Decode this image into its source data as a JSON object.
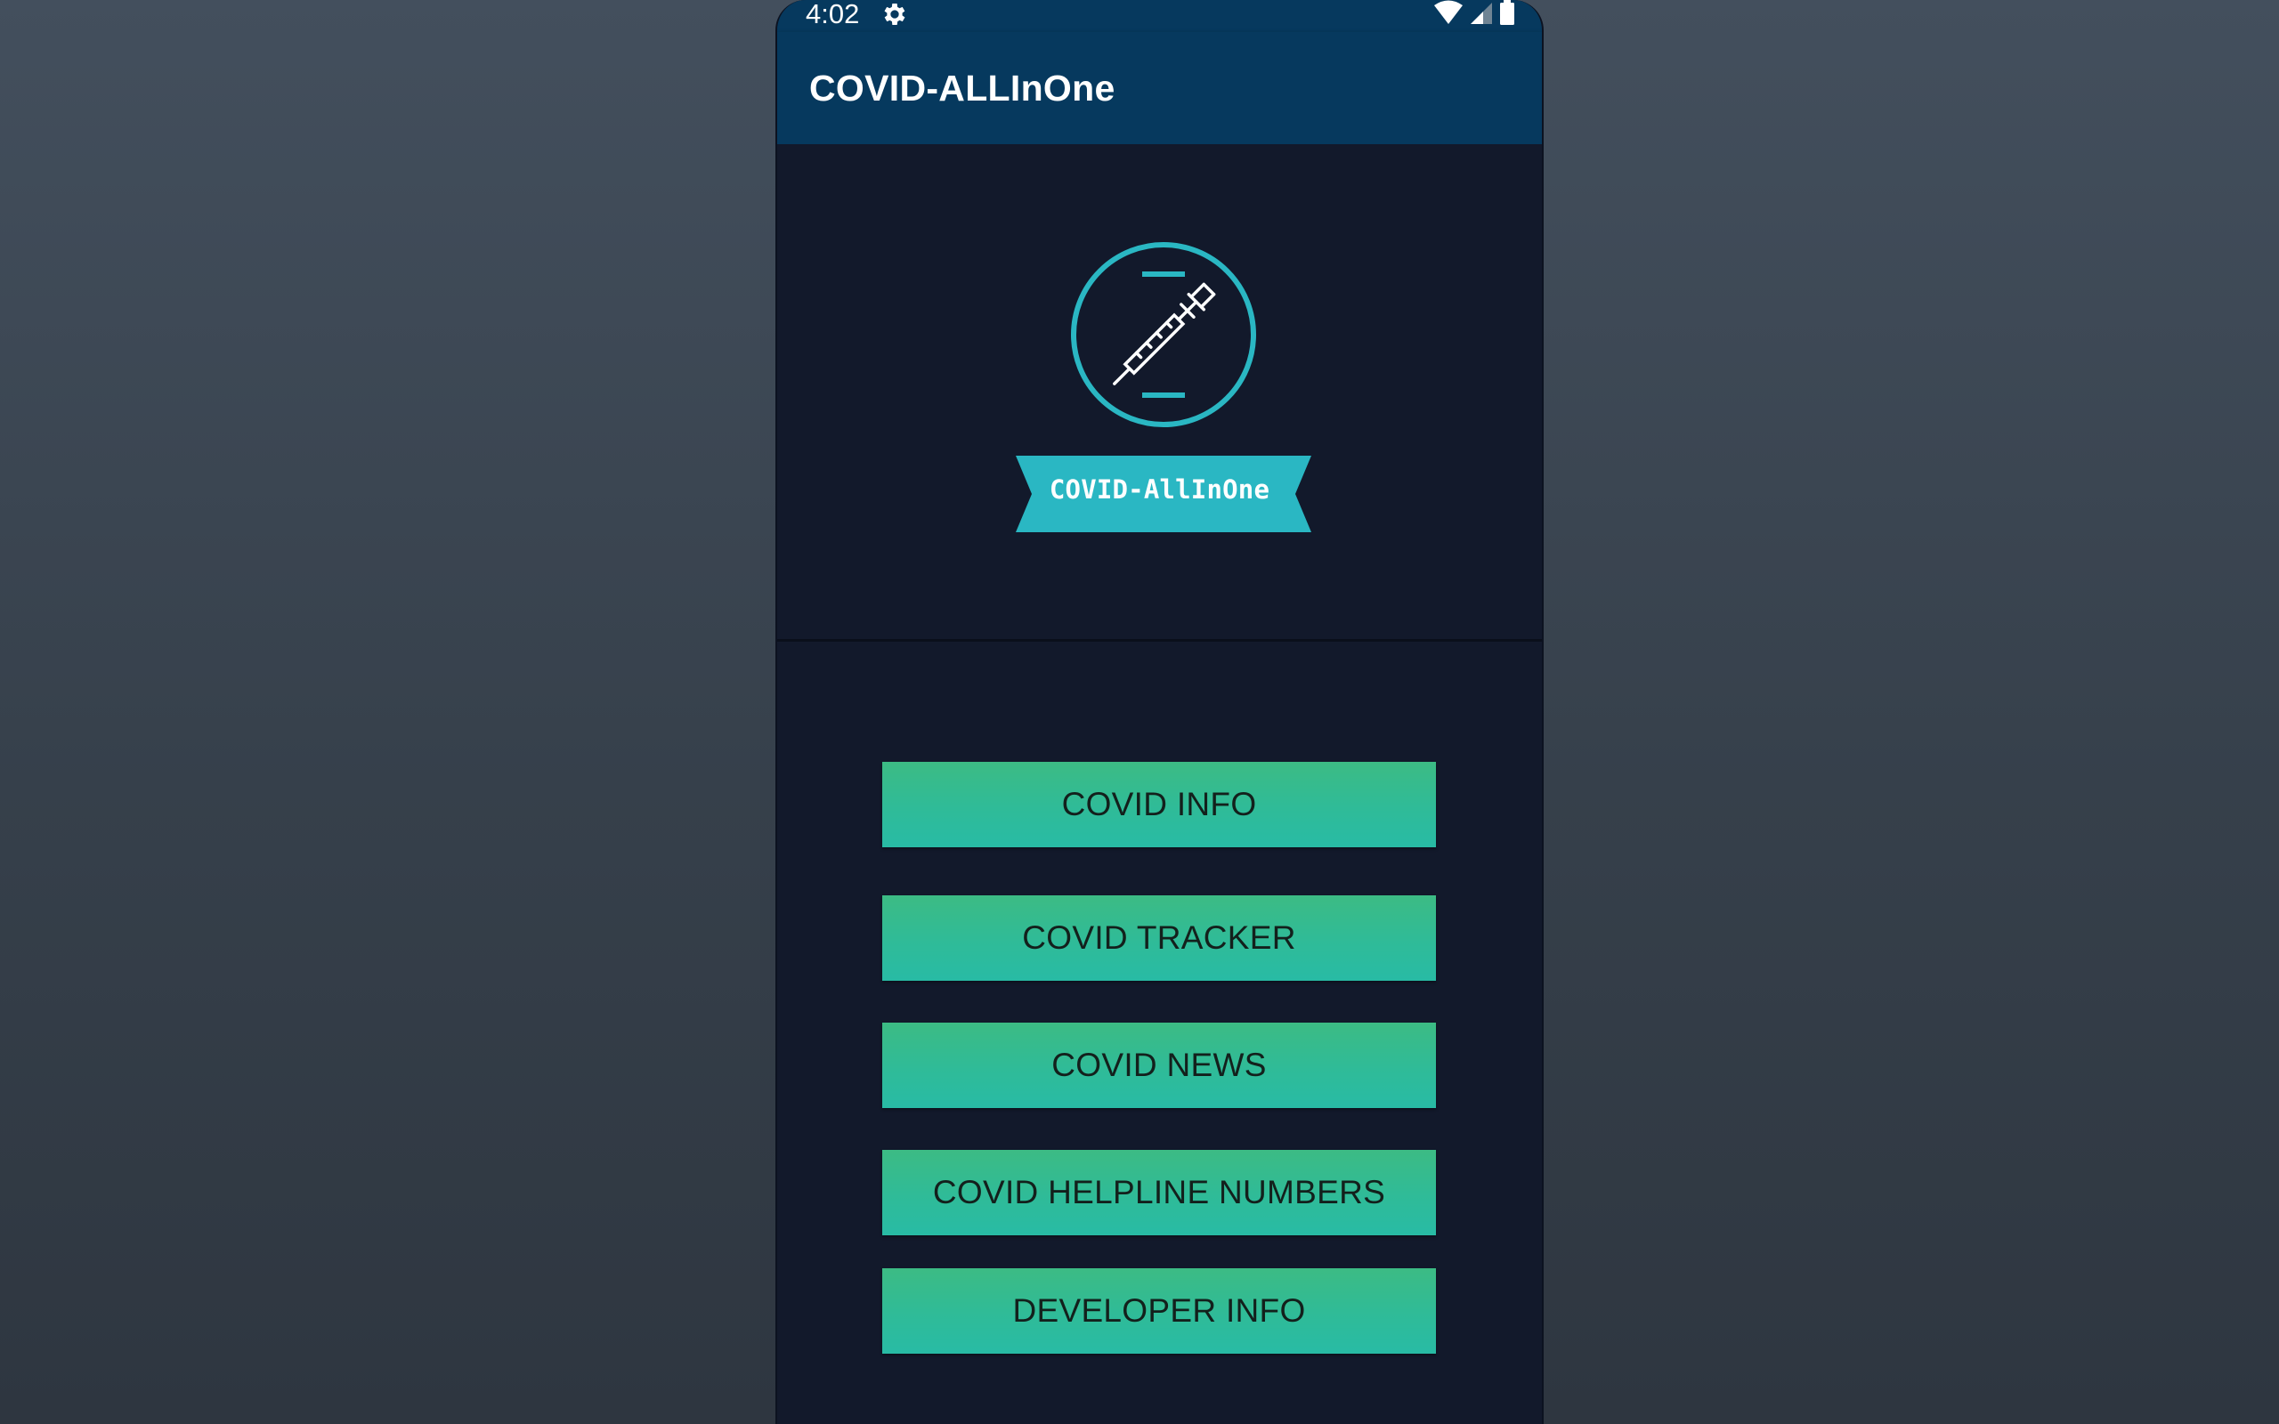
{
  "status_bar": {
    "time": "4:02",
    "icons": [
      "gear-icon",
      "wifi-icon",
      "signal-icon",
      "battery-icon"
    ]
  },
  "app_bar": {
    "title": "COVID-ALLInOne"
  },
  "logo": {
    "icon": "syringe-icon",
    "ribbon_text": "COVID-AllInOne",
    "accent_color": "#2ab7c3"
  },
  "menu": {
    "buttons": [
      {
        "label": "COVID INFO"
      },
      {
        "label": "COVID TRACKER"
      },
      {
        "label": "COVID NEWS"
      },
      {
        "label": "COVID HELPLINE NUMBERS"
      },
      {
        "label": "DEVELOPER INFO"
      }
    ]
  },
  "colors": {
    "app_bar": "#06395e",
    "screen_background": "#12192b",
    "button_gradient_top": "#3cbb84",
    "button_gradient_bottom": "#28bba5"
  }
}
